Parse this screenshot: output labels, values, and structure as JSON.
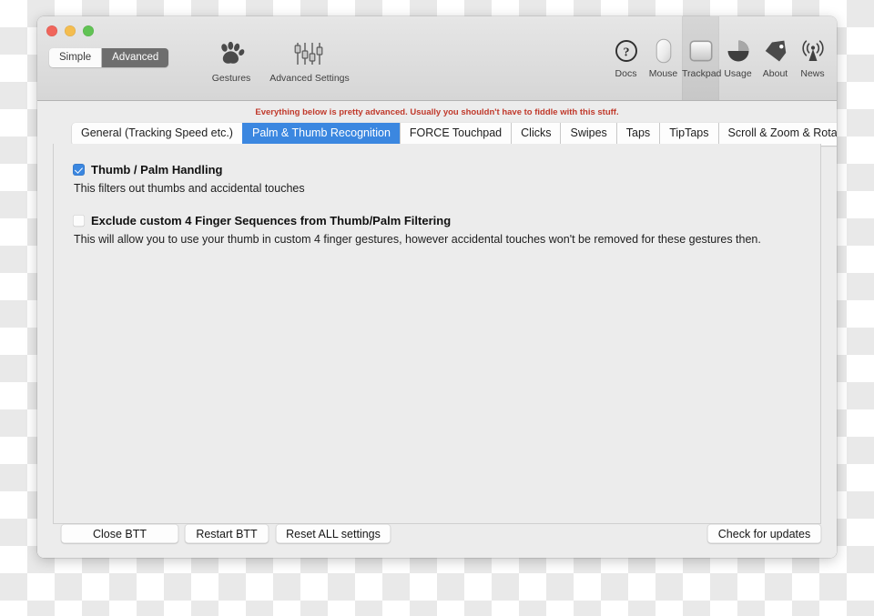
{
  "window": {
    "traffic_lights": [
      {
        "name": "close",
        "color": "#f0655b"
      },
      {
        "name": "minimize",
        "color": "#f4bd4f"
      },
      {
        "name": "zoom",
        "color": "#61c354"
      }
    ]
  },
  "toolbar": {
    "mode_segments": [
      {
        "label": "Simple",
        "active": false
      },
      {
        "label": "Advanced",
        "active": true
      }
    ],
    "left_items": [
      {
        "label": "Gestures",
        "icon": "paw-icon",
        "wide": false
      },
      {
        "label": "Advanced Settings",
        "icon": "sliders-icon",
        "wide": true
      }
    ],
    "right_items": [
      {
        "label": "Docs",
        "icon": "question-circle-icon",
        "selected": false
      },
      {
        "label": "Mouse",
        "icon": "mouse-icon",
        "selected": false
      },
      {
        "label": "Trackpad",
        "icon": "trackpad-icon",
        "selected": true
      },
      {
        "label": "Usage",
        "icon": "pie-chart-icon",
        "selected": false
      },
      {
        "label": "About",
        "icon": "tag-icon",
        "selected": false
      },
      {
        "label": "News",
        "icon": "broadcast-icon",
        "selected": false
      }
    ]
  },
  "warning": {
    "text": "Everything below is pretty advanced. Usually you shouldn't have to fiddle with this stuff.",
    "color": "#c0392b"
  },
  "tabs": [
    {
      "label": "General (Tracking Speed etc.)",
      "active": false
    },
    {
      "label": "Palm & Thumb Recognition",
      "active": true
    },
    {
      "label": "FORCE Touchpad",
      "active": false
    },
    {
      "label": "Clicks",
      "active": false
    },
    {
      "label": "Swipes",
      "active": false
    },
    {
      "label": "Taps",
      "active": false
    },
    {
      "label": "TipTaps",
      "active": false
    },
    {
      "label": "Scroll & Zoom & Rotate",
      "active": false
    }
  ],
  "panel": {
    "options": [
      {
        "title": "Thumb / Palm Handling",
        "checked": true,
        "description": "This filters out thumbs and accidental touches"
      },
      {
        "title": "Exclude custom 4 Finger Sequences from Thumb/Palm Filtering",
        "checked": false,
        "description": "This will allow you to use your thumb in custom 4 finger gestures, however accidental touches won't be removed for these gestures then."
      }
    ]
  },
  "buttons": {
    "close_btt": "Close BTT",
    "restart_btt": "Restart BTT",
    "reset_all": "Reset ALL settings",
    "check_updates": "Check for updates"
  },
  "accent_color": "#3b87e0"
}
